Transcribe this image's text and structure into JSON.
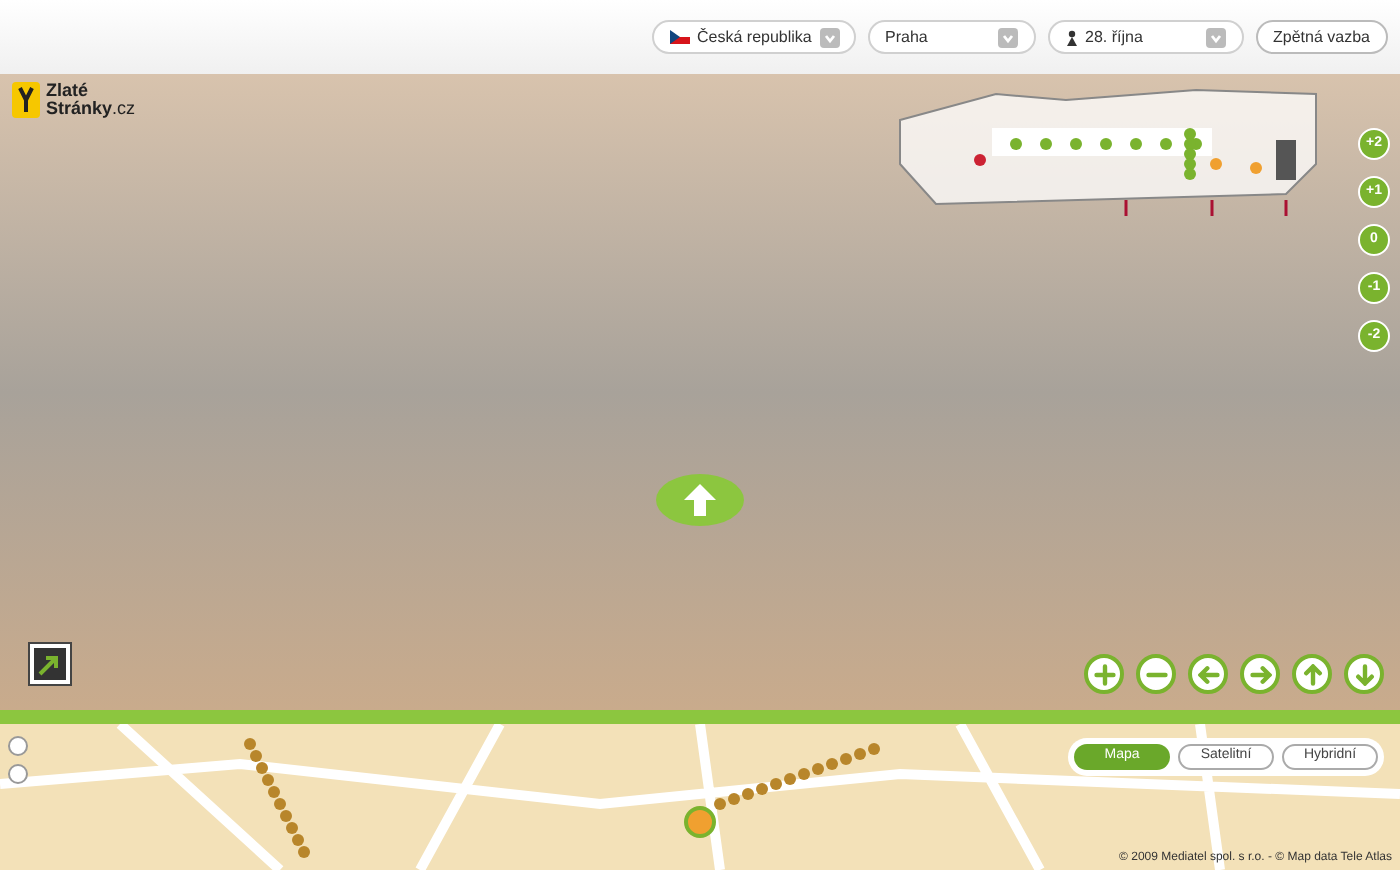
{
  "toolbar": {
    "country": "Česká republika",
    "city": "Praha",
    "street": "28. října",
    "feedback_button": "Zpětná vazba"
  },
  "logo": {
    "line1": "Zlaté",
    "line2": "Stránky",
    "suffix": ".cz"
  },
  "floors": [
    {
      "label": "+2"
    },
    {
      "label": "+1"
    },
    {
      "label": "0"
    },
    {
      "label": "-1"
    },
    {
      "label": "-2"
    }
  ],
  "nav_buttons": [
    {
      "kind": "zoom-in"
    },
    {
      "kind": "zoom-out"
    },
    {
      "kind": "left"
    },
    {
      "kind": "right"
    },
    {
      "kind": "up"
    },
    {
      "kind": "down"
    }
  ],
  "map": {
    "types": [
      {
        "label": "Mapa",
        "selected": true
      },
      {
        "label": "Satelitní",
        "selected": false
      },
      {
        "label": "Hybridní",
        "selected": false
      }
    ],
    "copyright": "© 2009 Mediatel spol. s r.o. - © Map data Tele Atlas"
  }
}
